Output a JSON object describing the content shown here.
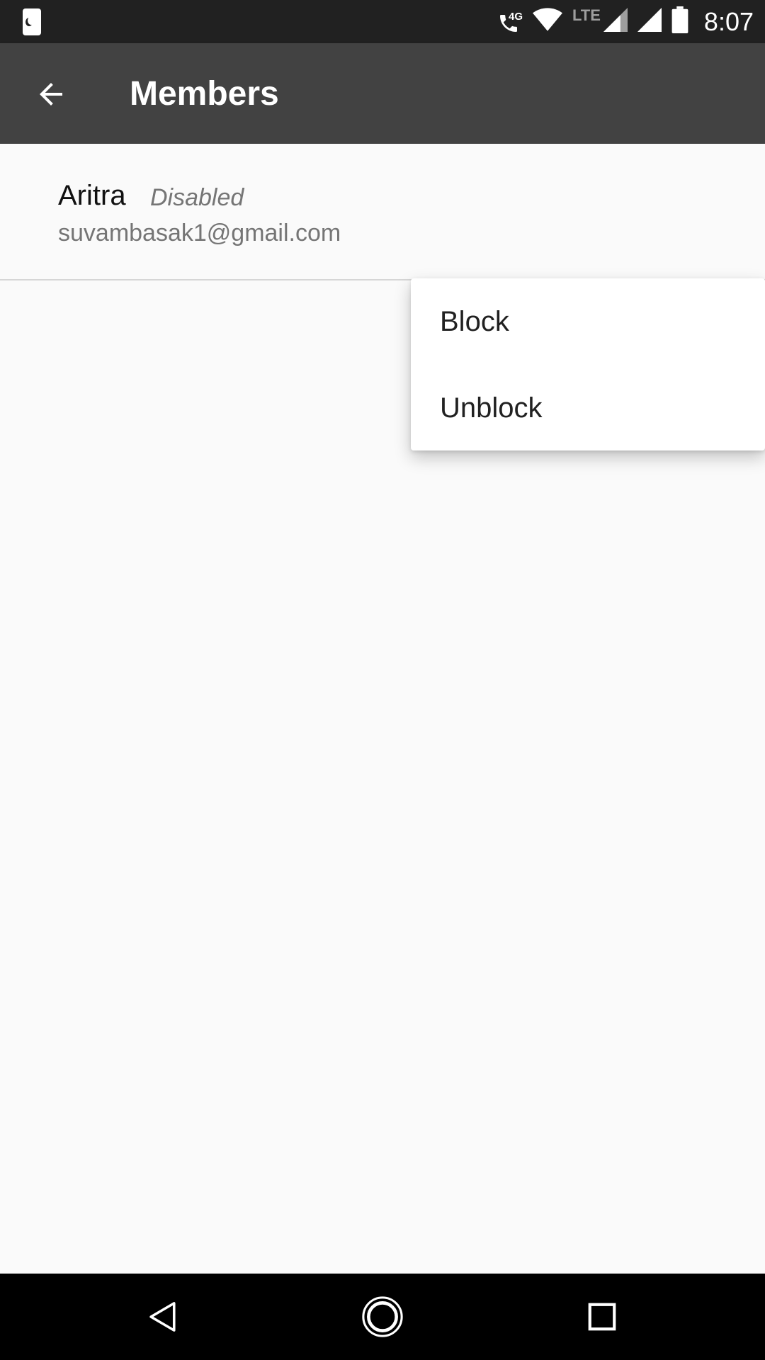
{
  "status_bar": {
    "network_label": "4G",
    "lte_label": "LTE",
    "time": "8:07",
    "icons": [
      "night-mode-icon",
      "wifi-call-icon",
      "wifi-icon",
      "signal-icon",
      "signal-icon",
      "battery-icon"
    ]
  },
  "app_bar": {
    "back_icon": "arrow-back-icon",
    "title": "Members"
  },
  "members": [
    {
      "name": "Aritra",
      "status": "Disabled",
      "email": "suvambasak1@gmail.com"
    }
  ],
  "popup_menu": {
    "items": [
      {
        "label": "Block"
      },
      {
        "label": "Unblock"
      }
    ]
  },
  "nav_bar": {
    "icons": [
      "nav-back-icon",
      "nav-home-icon",
      "nav-recents-icon"
    ]
  },
  "colors": {
    "status_bar": "#212121",
    "app_bar": "#424242",
    "background": "#fafafa",
    "menu_background": "#ffffff",
    "nav_bar": "#000000"
  }
}
